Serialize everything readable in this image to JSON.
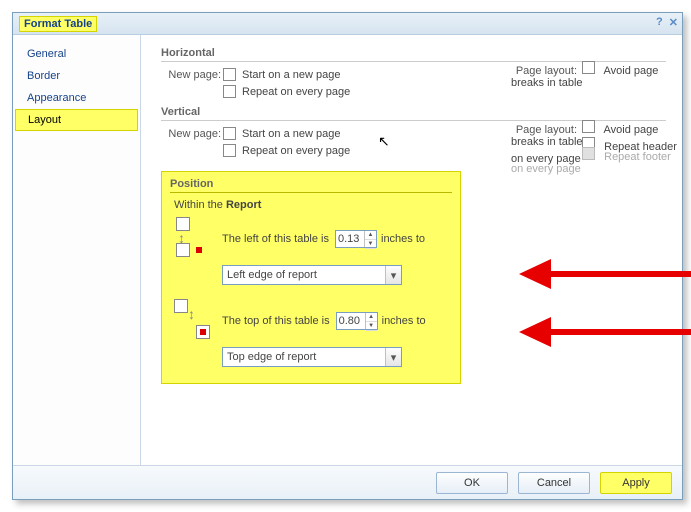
{
  "title": "Format Table",
  "sidebar": {
    "items": [
      {
        "label": "General"
      },
      {
        "label": "Border"
      },
      {
        "label": "Appearance"
      },
      {
        "label": "Layout"
      }
    ]
  },
  "groups": {
    "horizontal": {
      "label": "Horizontal",
      "newpage_label": "New page:",
      "startnew": "Start on a new page",
      "repeat": "Repeat on every page",
      "layout_label": "Page layout:",
      "avoid": "Avoid page breaks in table"
    },
    "vertical": {
      "label": "Vertical",
      "newpage_label": "New page:",
      "startnew": "Start on a new page",
      "repeat": "Repeat on every page",
      "layout_label": "Page layout:",
      "avoid": "Avoid page breaks in table",
      "repeat_header": "Repeat header on every page",
      "repeat_footer": "Repeat footer on every page"
    },
    "position": {
      "label": "Position",
      "within_prefix": "Within the ",
      "within_scope": "Report",
      "left_text": "The left of this table is",
      "left_value": "0.13",
      "left_unit": "inches to",
      "left_ref": "Left edge of report",
      "top_text": "The top of this table is",
      "top_value": "0.80",
      "top_unit": "inches to",
      "top_ref": "Top edge of report"
    }
  },
  "footer": {
    "ok": "OK",
    "cancel": "Cancel",
    "apply": "Apply"
  },
  "icons": {
    "help": "?",
    "close": "✕",
    "dd": "▾",
    "up": "▲",
    "down": "▼"
  }
}
